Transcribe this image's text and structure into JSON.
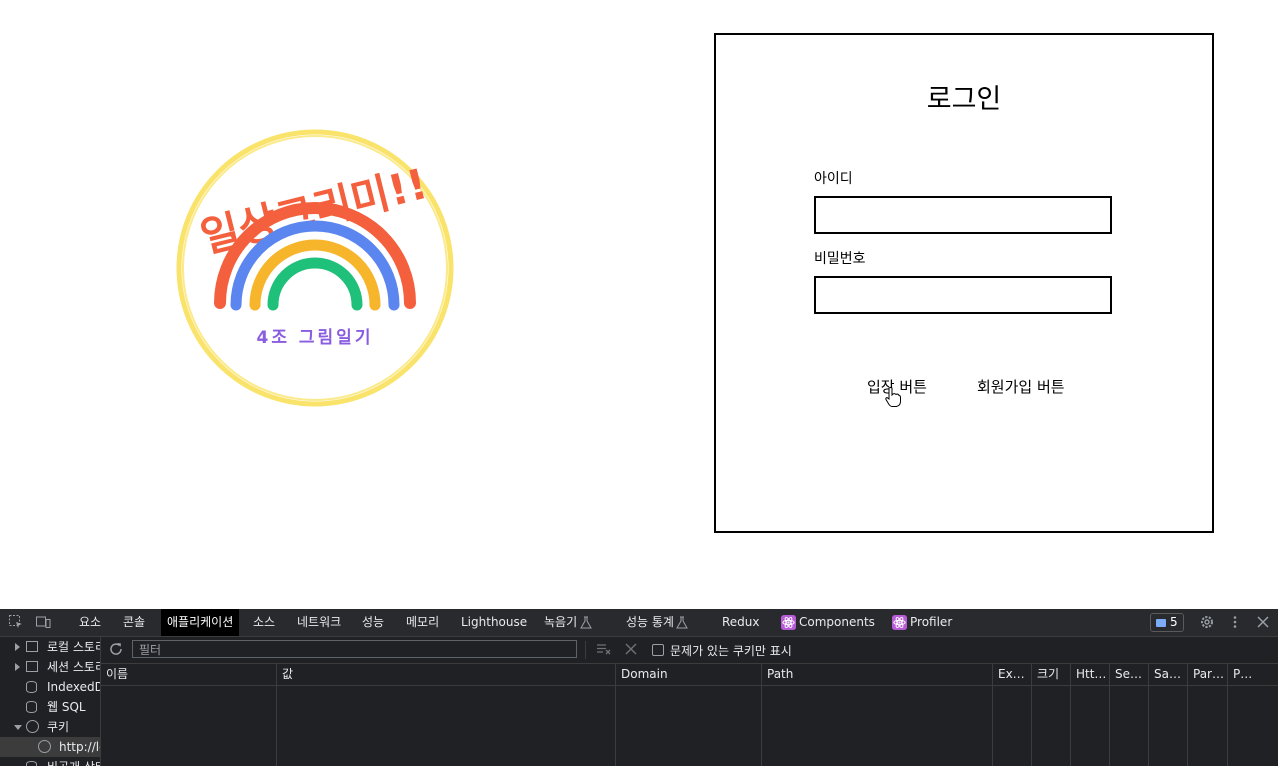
{
  "logo": {
    "title_text": "일상그리미!!",
    "subtitle_text": "4조 그림일기"
  },
  "login": {
    "title": "로그인",
    "id_label": "아이디",
    "pw_label": "비밀번호",
    "enter_button": "입장 버튼",
    "signup_button": "회원가입 버튼"
  },
  "devtools": {
    "tabs": [
      "요소",
      "콘솔",
      "애플리케이션",
      "소스",
      "네트워크",
      "성능",
      "메모리",
      "Lighthouse",
      "녹음기",
      "성능 통계",
      "Redux",
      "Components",
      "Profiler"
    ],
    "active_tab": "애플리케이션",
    "issues_count": "5",
    "sidebar": {
      "local_storage": "로컬 스토리지",
      "session_storage": "세션 스토리지",
      "indexeddb": "IndexedDB",
      "websql": "웹 SQL",
      "cookies": "쿠키",
      "cookie_origin": "http://localhost",
      "private_state": "비공개 상태 토큰"
    },
    "filter_placeholder": "필터",
    "only_issues_label": "문제가 있는 쿠키만 표시",
    "columns": [
      "이름",
      "값",
      "Domain",
      "Path",
      "Ex…",
      "크기",
      "Htt…",
      "Se…",
      "Sa…",
      "Par…",
      "P…"
    ]
  },
  "colors": {
    "devtools_bg": "#202124",
    "tabbar_bg": "#292a2d",
    "react_icon": "#b65cd6",
    "rainbow_red": "#f4603e",
    "rainbow_blue": "#5b86f0",
    "rainbow_yellow": "#f7b52c",
    "rainbow_green": "#1fc07a",
    "logo_ring": "#f9e36a"
  }
}
